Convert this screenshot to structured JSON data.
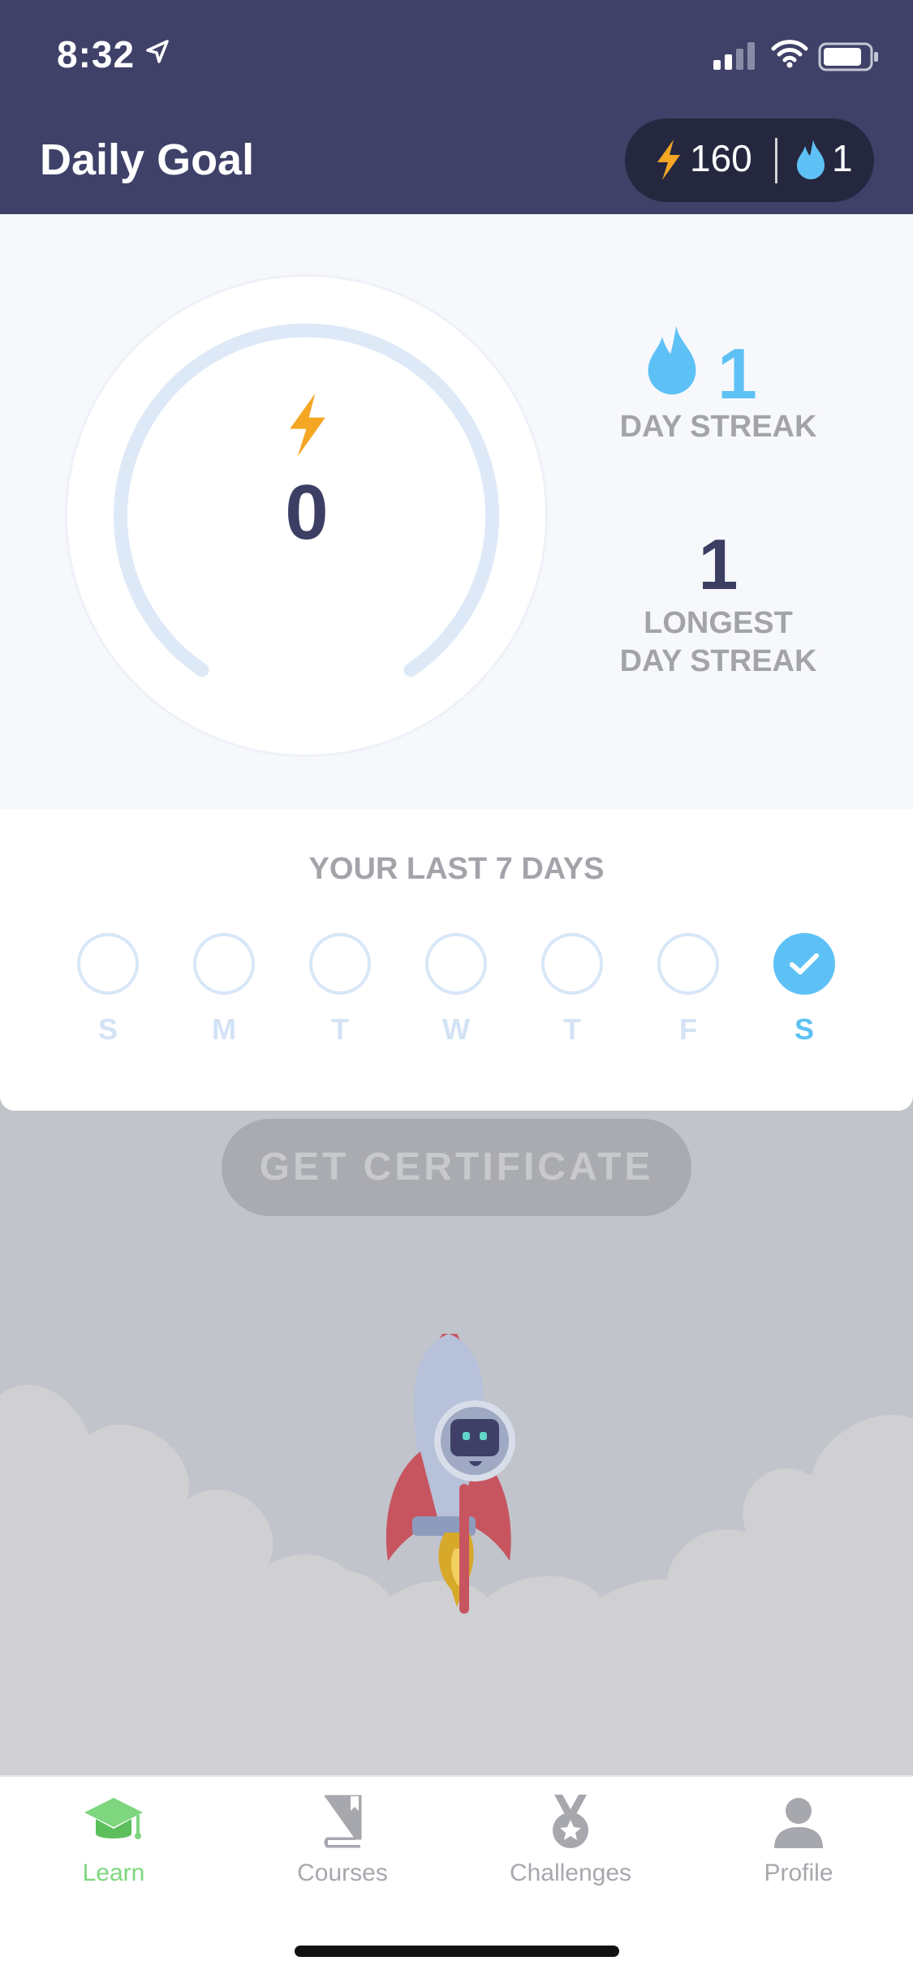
{
  "status_bar": {
    "time": "8:32",
    "icons": [
      "location-arrow-icon",
      "signal-icon",
      "wifi-icon",
      "battery-icon"
    ]
  },
  "header": {
    "title": "Daily Goal",
    "xp_count": "160",
    "streak_count": "1"
  },
  "daily_goal": {
    "xp_today": "0",
    "progress": 0,
    "day_streak_value": "1",
    "day_streak_label": "DAY STREAK",
    "longest_streak_value": "1",
    "longest_streak_label_line1": "LONGEST",
    "longest_streak_label_line2": "DAY STREAK"
  },
  "week": {
    "title": "YOUR LAST 7 DAYS",
    "days": [
      {
        "label": "S",
        "completed": false
      },
      {
        "label": "M",
        "completed": false
      },
      {
        "label": "T",
        "completed": false
      },
      {
        "label": "W",
        "completed": false
      },
      {
        "label": "T",
        "completed": false
      },
      {
        "label": "F",
        "completed": false
      },
      {
        "label": "S",
        "completed": true
      }
    ]
  },
  "certificate_button": "GET CERTIFICATE",
  "tabs": [
    {
      "label": "Learn",
      "icon": "graduation-cap-icon",
      "active": true
    },
    {
      "label": "Courses",
      "icon": "book-icon",
      "active": false
    },
    {
      "label": "Challenges",
      "icon": "medal-icon",
      "active": false
    },
    {
      "label": "Profile",
      "icon": "person-icon",
      "active": false
    }
  ],
  "colors": {
    "header_bg": "#3f4168",
    "accent_blue": "#5ec1f6",
    "accent_green": "#7ed67e",
    "xp_orange": "#f5a623",
    "dark_text": "#3c3e63"
  }
}
